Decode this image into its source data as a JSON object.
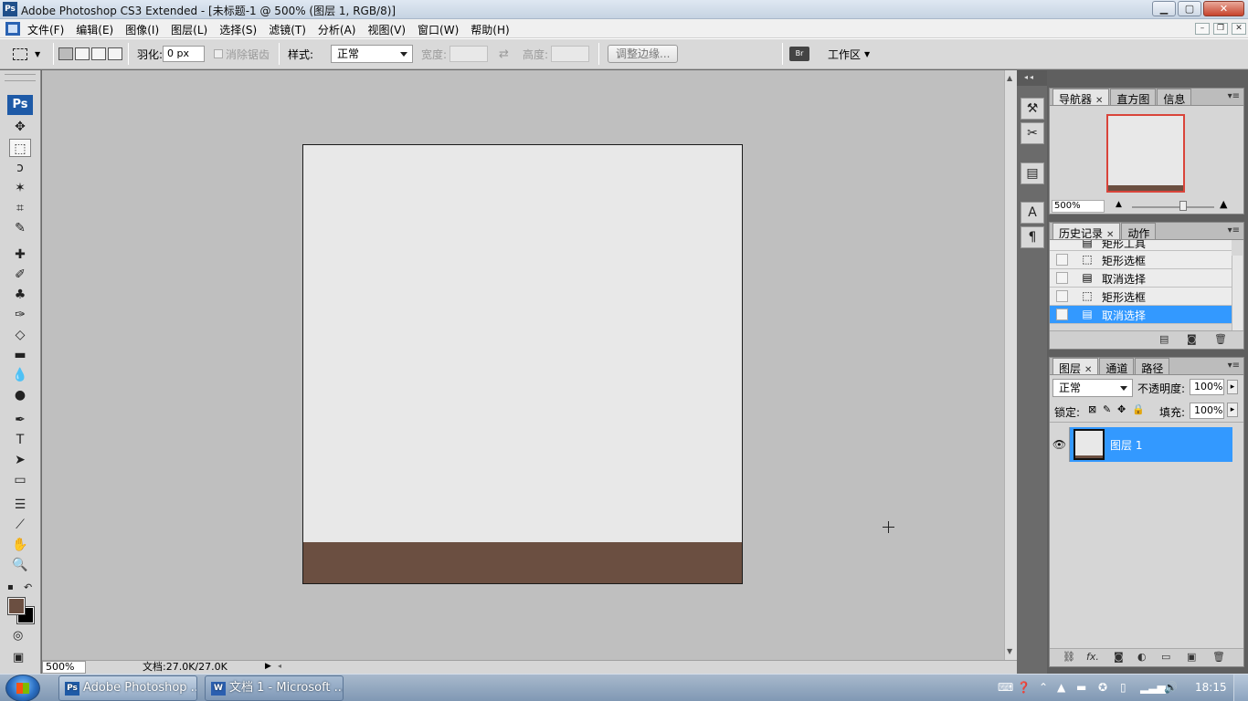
{
  "window": {
    "title": "Adobe Photoshop CS3 Extended - [未标题-1 @ 500% (图层 1, RGB/8)]",
    "icon": "Ps",
    "min": "▁",
    "max": "▢",
    "close": "✕"
  },
  "menu": {
    "items": [
      "文件(F)",
      "编辑(E)",
      "图像(I)",
      "图层(L)",
      "选择(S)",
      "滤镜(T)",
      "分析(A)",
      "视图(V)",
      "窗口(W)",
      "帮助(H)"
    ],
    "mdi_min": "–",
    "mdi_restore": "❐",
    "mdi_close": "✕"
  },
  "options": {
    "feather_label": "羽化:",
    "feather_value": "0 px",
    "antialias_label": "消除锯齿",
    "style_label": "样式:",
    "style_value": "正常",
    "width_label": "宽度:",
    "height_label": "高度:",
    "swap_icon": "⇄",
    "refine_button": "调整边缘...",
    "workspace_label": "工作区"
  },
  "toolbox": {
    "badge": "Ps",
    "tools": [
      {
        "name": "move-tool-icon",
        "glyph": "✥"
      },
      {
        "name": "rectangular-marquee-tool-icon",
        "glyph": "⬚"
      },
      {
        "name": "lasso-tool-icon",
        "glyph": "ↄ"
      },
      {
        "name": "magic-wand-tool-icon",
        "glyph": "✶"
      },
      {
        "name": "crop-tool-icon",
        "glyph": "⌗"
      },
      {
        "name": "slice-tool-icon",
        "glyph": "✎"
      },
      {
        "name": "healing-brush-tool-icon",
        "glyph": "✚"
      },
      {
        "name": "brush-tool-icon",
        "glyph": "✐"
      },
      {
        "name": "clone-stamp-tool-icon",
        "glyph": "♣"
      },
      {
        "name": "history-brush-tool-icon",
        "glyph": "✑"
      },
      {
        "name": "eraser-tool-icon",
        "glyph": "◇"
      },
      {
        "name": "gradient-tool-icon",
        "glyph": "▬"
      },
      {
        "name": "blur-tool-icon",
        "glyph": "💧"
      },
      {
        "name": "dodge-tool-icon",
        "glyph": "●"
      },
      {
        "name": "pen-tool-icon",
        "glyph": "✒"
      },
      {
        "name": "type-tool-icon",
        "glyph": "T"
      },
      {
        "name": "path-selection-tool-icon",
        "glyph": "➤"
      },
      {
        "name": "rectangle-tool-icon",
        "glyph": "▭"
      },
      {
        "name": "notes-tool-icon",
        "glyph": "☰"
      },
      {
        "name": "eyedropper-tool-icon",
        "glyph": "⟋"
      },
      {
        "name": "hand-tool-icon",
        "glyph": "✋"
      },
      {
        "name": "zoom-tool-icon",
        "glyph": "🔍"
      }
    ],
    "foreground_color": "#6b4f41",
    "background_color": "#000000",
    "quickmask_icon": "◎",
    "screenmode_icon": "▣"
  },
  "document": {
    "fill_color": "#e8e8e8",
    "band_color": "#6b4f41"
  },
  "statusbar": {
    "zoom": "500%",
    "doc_info": "文档:27.0K/27.0K",
    "play": "▶",
    "scroll_left": "◂"
  },
  "navigator": {
    "tabs": [
      "导航器",
      "直方图",
      "信息"
    ],
    "zoom": "500%"
  },
  "history": {
    "tabs": [
      "历史记录",
      "动作"
    ],
    "items": [
      {
        "label": "矩形工具",
        "icon": "▤"
      },
      {
        "label": "矩形选框",
        "icon": "⬚"
      },
      {
        "label": "取消选择",
        "icon": "▤"
      },
      {
        "label": "矩形选框",
        "icon": "⬚"
      },
      {
        "label": "取消选择",
        "icon": "▤",
        "selected": true
      }
    ]
  },
  "layers": {
    "tabs": [
      "图层",
      "通道",
      "路径"
    ],
    "blend_mode": "正常",
    "opacity_label": "不透明度:",
    "opacity_value": "100%",
    "lock_label": "锁定:",
    "fill_label": "填充:",
    "fill_value": "100%",
    "layer_name": "图层 1"
  },
  "taskbar": {
    "buttons": [
      {
        "label": "Adobe Photoshop ...",
        "icon": "Ps"
      },
      {
        "label": "文档 1 - Microsoft ...",
        "icon": "W"
      }
    ],
    "clock": "18:15"
  }
}
